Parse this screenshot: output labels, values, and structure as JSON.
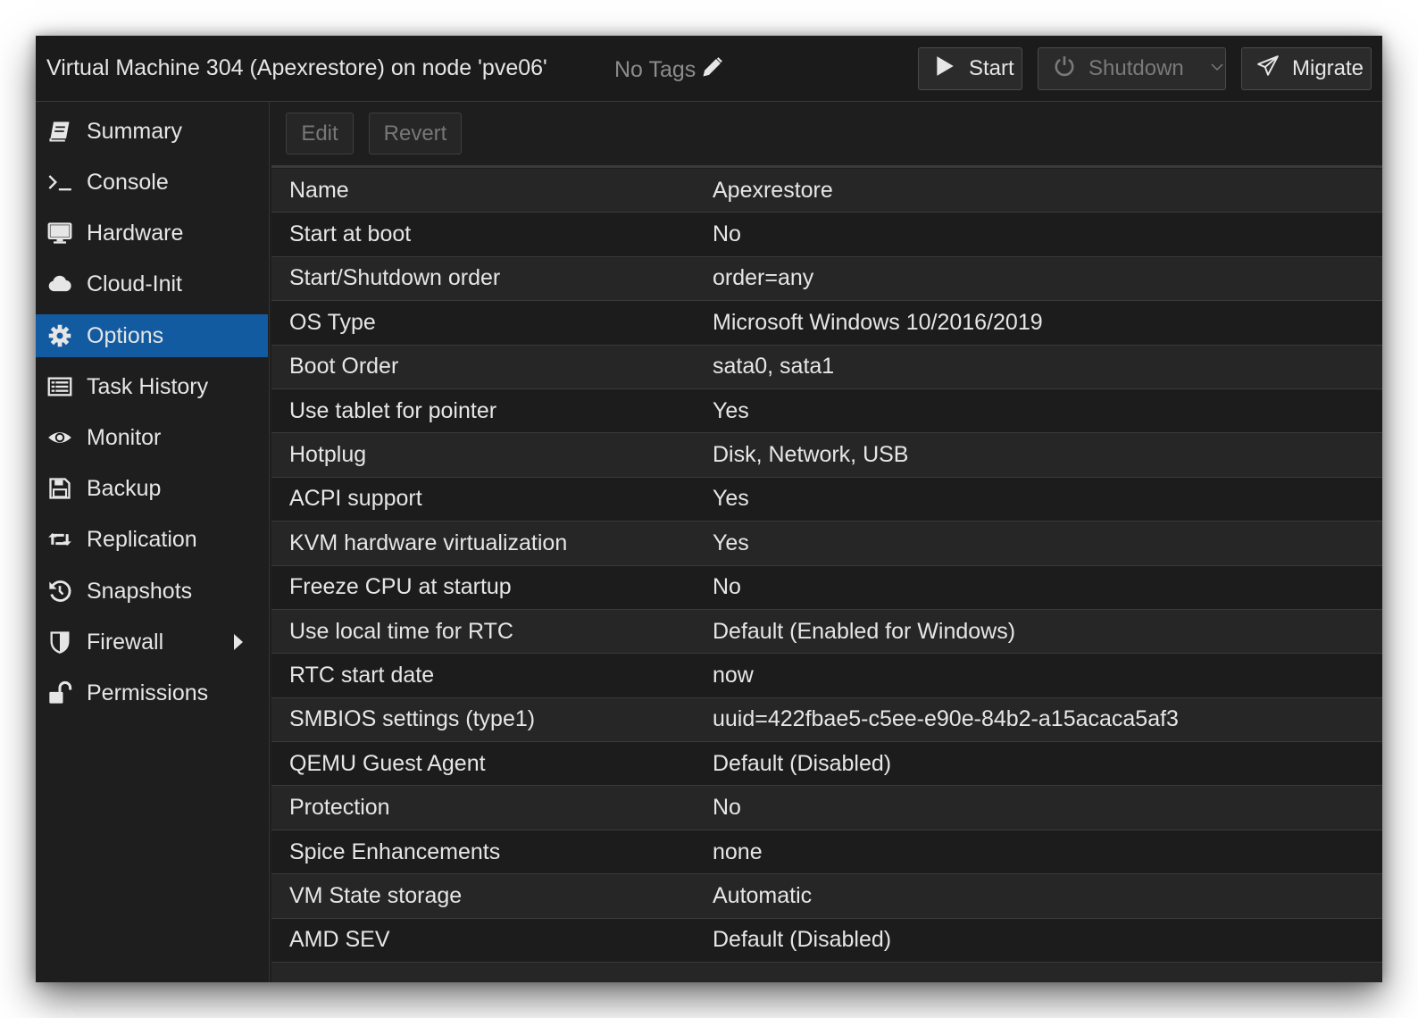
{
  "header": {
    "title": "Virtual Machine 304 (Apexrestore) on node 'pve06'",
    "tags_label": "No Tags",
    "start_label": "Start",
    "shutdown_label": "Shutdown",
    "migrate_label": "Migrate"
  },
  "sidebar": {
    "items": [
      {
        "label": "Summary",
        "icon": "book-icon"
      },
      {
        "label": "Console",
        "icon": "terminal-icon"
      },
      {
        "label": "Hardware",
        "icon": "monitor-icon"
      },
      {
        "label": "Cloud-Init",
        "icon": "cloud-icon"
      },
      {
        "label": "Options",
        "icon": "gear-icon",
        "active": true
      },
      {
        "label": "Task History",
        "icon": "list-icon"
      },
      {
        "label": "Monitor",
        "icon": "eye-icon"
      },
      {
        "label": "Backup",
        "icon": "floppy-icon"
      },
      {
        "label": "Replication",
        "icon": "retweet-icon"
      },
      {
        "label": "Snapshots",
        "icon": "history-icon"
      },
      {
        "label": "Firewall",
        "icon": "shield-icon",
        "has_submenu": true
      },
      {
        "label": "Permissions",
        "icon": "unlock-icon"
      }
    ]
  },
  "toolbar": {
    "edit_label": "Edit",
    "revert_label": "Revert"
  },
  "options": [
    {
      "key": "Name",
      "value": "Apexrestore"
    },
    {
      "key": "Start at boot",
      "value": "No"
    },
    {
      "key": "Start/Shutdown order",
      "value": "order=any"
    },
    {
      "key": "OS Type",
      "value": "Microsoft Windows 10/2016/2019"
    },
    {
      "key": "Boot Order",
      "value": "sata0, sata1"
    },
    {
      "key": "Use tablet for pointer",
      "value": "Yes"
    },
    {
      "key": "Hotplug",
      "value": "Disk, Network, USB"
    },
    {
      "key": "ACPI support",
      "value": "Yes"
    },
    {
      "key": "KVM hardware virtualization",
      "value": "Yes"
    },
    {
      "key": "Freeze CPU at startup",
      "value": "No"
    },
    {
      "key": "Use local time for RTC",
      "value": "Default (Enabled for Windows)"
    },
    {
      "key": "RTC start date",
      "value": "now"
    },
    {
      "key": "SMBIOS settings (type1)",
      "value": "uuid=422fbae5-c5ee-e90e-84b2-a15acaca5af3"
    },
    {
      "key": "QEMU Guest Agent",
      "value": "Default (Disabled)"
    },
    {
      "key": "Protection",
      "value": "No"
    },
    {
      "key": "Spice Enhancements",
      "value": "none"
    },
    {
      "key": "VM State storage",
      "value": "Automatic"
    },
    {
      "key": "AMD SEV",
      "value": "Default (Disabled)"
    },
    {
      "key": "",
      "value": ""
    }
  ],
  "colors": {
    "accent": "#135ba1",
    "background": "#1e1e1e",
    "text": "#e6e6e6"
  }
}
